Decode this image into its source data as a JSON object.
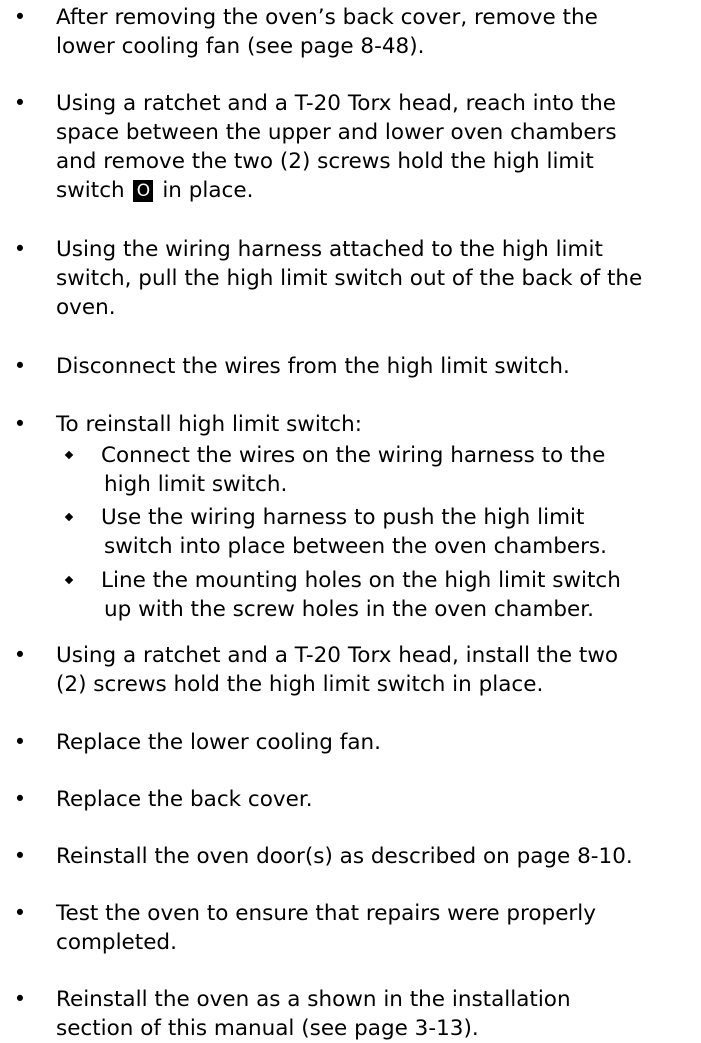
{
  "steps": [
    {
      "lines": [
        "After removing the oven’s back cover, remove the",
        "lower cooling fan (see page 8-48)."
      ]
    },
    {
      "lines": [
        "Using a ratchet and a T-20 Torx head, reach into the",
        "space between the upper and lower oven chambers",
        "and remove the two (2) screws hold the high limit"
      ],
      "last_before": "switch",
      "callout": "O",
      "last_after": "in place."
    },
    {
      "lines": [
        "Using the wiring harness attached to the high limit",
        "switch, pull the high limit switch out of the back of the",
        "oven."
      ]
    },
    {
      "lines": [
        "Disconnect the wires from the high limit switch."
      ]
    },
    {
      "lines": [
        "To reinstall high limit switch:"
      ]
    },
    {
      "lines": [
        "Using a ratchet and a T-20 Torx head, install the two",
        "(2) screws hold the high limit switch in place."
      ]
    },
    {
      "lines": [
        "Replace the lower cooling fan."
      ]
    },
    {
      "lines": [
        "Replace the back cover."
      ]
    },
    {
      "lines": [
        "Reinstall the oven door(s) as described on page 8-10."
      ]
    },
    {
      "lines": [
        "Test the oven to ensure that repairs were properly",
        "completed."
      ]
    },
    {
      "lines": [
        "Reinstall the oven as a shown in the installation",
        "section of this manual (see page 3-13)."
      ]
    }
  ],
  "substeps": [
    {
      "lines": [
        "Connect the wires on the wiring harness to the",
        "high limit switch."
      ]
    },
    {
      "lines": [
        "Use the wiring harness to push the high limit",
        "switch into place between the oven chambers."
      ]
    },
    {
      "lines": [
        "Line the mounting holes on the high limit switch",
        "up with the screw holes in the oven chamber."
      ]
    }
  ]
}
